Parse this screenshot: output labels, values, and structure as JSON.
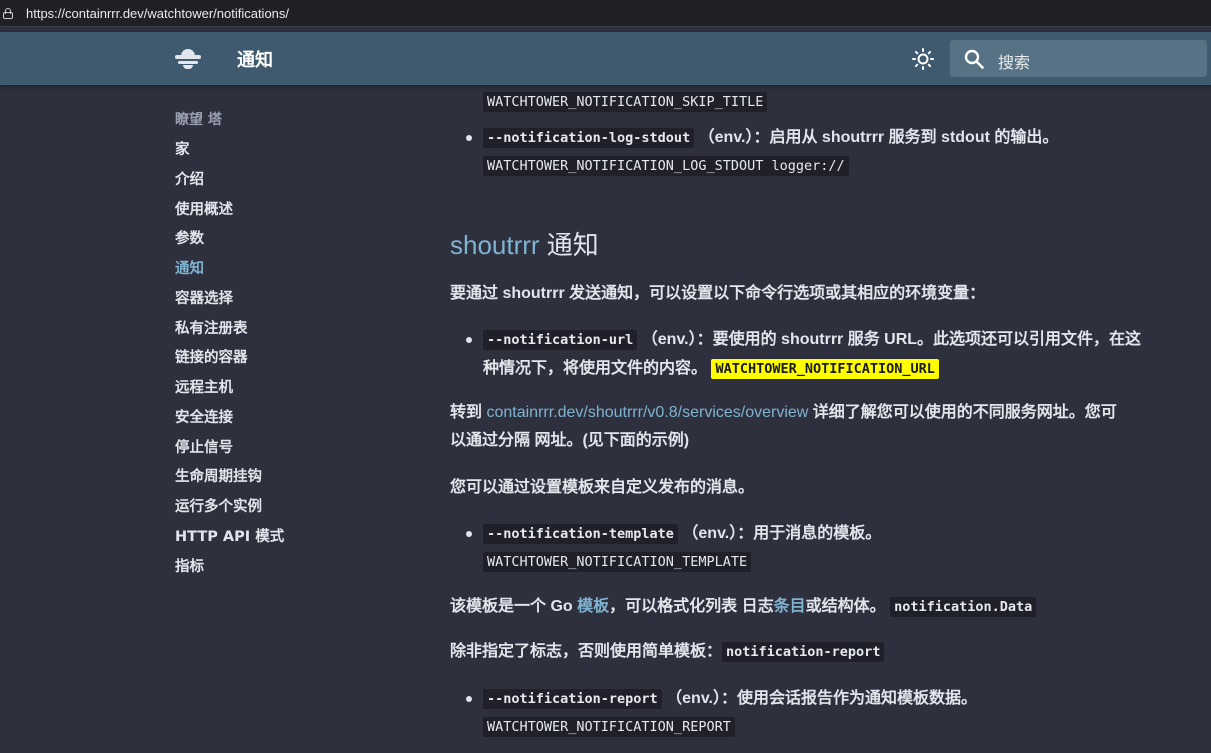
{
  "browser": {
    "url": "https://containrrr.dev/watchtower/notifications/"
  },
  "header": {
    "title": "通知",
    "search_placeholder": "搜索"
  },
  "sidebar": {
    "title": "瞭望 塔",
    "items": [
      {
        "label": "家"
      },
      {
        "label": "介绍"
      },
      {
        "label": "使用概述"
      },
      {
        "label": "参数"
      },
      {
        "label": "通知",
        "active": true
      },
      {
        "label": "容器选择"
      },
      {
        "label": "私有注册表"
      },
      {
        "label": "链接的容器"
      },
      {
        "label": "远程主机"
      },
      {
        "label": "安全连接"
      },
      {
        "label": "停止信号"
      },
      {
        "label": "生命周期挂钩"
      },
      {
        "label": "运行多个实例"
      },
      {
        "label": "HTTP API 模式"
      },
      {
        "label": "指标"
      }
    ]
  },
  "content": {
    "skip_title_env": "WATCHTOWER_NOTIFICATION_SKIP_TITLE",
    "log_stdout": {
      "flag": "--notification-log-stdout",
      "desc": "（env.）：启用从 shoutrrr 服务到 stdout 的输出。",
      "env": "WATCHTOWER_NOTIFICATION_LOG_STDOUT logger://"
    },
    "heading": {
      "accent": "shoutrrr",
      "rest": " 通知"
    },
    "intro": "要通过 shoutrrr 发送通知，可以设置以下命令行选项或其相应的环境变量：",
    "url_option": {
      "flag": "--notification-url",
      "desc_line1": "（env.）：要使用的 shoutrrr 服务 URL。此选项还可以引用文件，在这",
      "desc_line2": "种情况下，将使用文件的内容。",
      "env": "WATCHTOWER_NOTIFICATION_URL"
    },
    "services": {
      "prefix": "转到 ",
      "link": "containrrr.dev/shoutrrr/v0.8/services/overview",
      "suffix": " 详细了解您可以使用的不同服务网址。您可",
      "line2": "以通过分隔 网址。(见下面的示例)"
    },
    "custom_template": "您可以通过设置模板来自定义发布的消息。",
    "template_option": {
      "flag": "--notification-template",
      "desc": "（env.）：用于消息的模板。",
      "env": "WATCHTOWER_NOTIFICATION_TEMPLATE"
    },
    "go_template": {
      "prefix": "该模板是一个 Go ",
      "link1": "模板",
      "middle": "，可以格式化列表 日志",
      "link2": "条目",
      "suffix": "或结构体。",
      "code": "notification.Data"
    },
    "simple_template": {
      "text": "除非指定了标志，否则使用简单模板：",
      "code": "notification-report"
    },
    "report_option": {
      "flag": "--notification-report",
      "desc": "（env.）：使用会话报告作为通知模板数据。",
      "env": "WATCHTOWER_NOTIFICATION_REPORT"
    }
  }
}
